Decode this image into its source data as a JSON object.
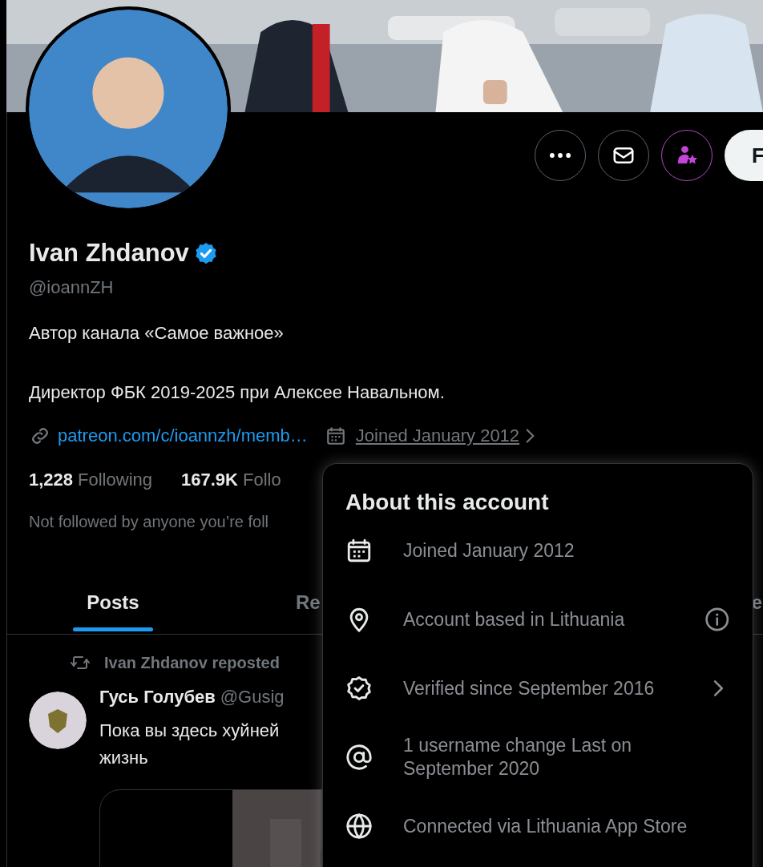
{
  "banner": {
    "kind": "picture"
  },
  "actions": [
    {
      "kind": "more"
    },
    {
      "kind": "message"
    },
    {
      "kind": "subscribe"
    },
    {
      "kind": "follow",
      "label": "F"
    }
  ],
  "profile": {
    "name": "Ivan Zhdanov",
    "verified": true,
    "handle": "@ioannZH",
    "bio": [
      "Автор канала «Самое важное»",
      "Директор ФБК 2019-2025 при Алексее Навальном."
    ],
    "link": "patreon.com/c/ioannzh/memb…",
    "joined": "Joined January 2012",
    "following_count": "1,228",
    "following_label": "Following",
    "followers_count": "167.9K",
    "followers_label": "Follo",
    "followed_by": "Not followed by anyone you’re foll"
  },
  "tabs": [
    {
      "label": "Posts",
      "selected": true
    },
    {
      "label": "Re",
      "selected": false
    },
    {
      "label": "e",
      "selected": false
    }
  ],
  "post": {
    "repost_label": "Ivan Zhdanov reposted",
    "author": "Гусь Голубев",
    "handle": "@Gusig",
    "text": [
      "Пока вы здесь хуйней",
      "жизнь"
    ],
    "media": {
      "kind": "picture"
    }
  },
  "popup": {
    "title": "About this account",
    "rows": [
      {
        "kind": "joined",
        "text": "Joined January 2012"
      },
      {
        "kind": "location",
        "text": "Account based in Lithuania",
        "trailing": {
          "kind": "info"
        }
      },
      {
        "kind": "verified",
        "text": "Verified since September 2016",
        "trailing": {
          "kind": "chevron"
        }
      },
      {
        "kind": "username",
        "text": "1 username change Last on September 2020"
      },
      {
        "kind": "connected",
        "text": "Connected via Lithuania App Store"
      }
    ]
  }
}
